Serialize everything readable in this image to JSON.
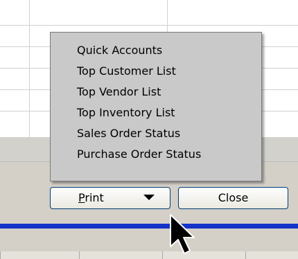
{
  "menu": {
    "items": [
      {
        "label": "Quick Accounts"
      },
      {
        "label": "Top Customer List"
      },
      {
        "label": "Top Vendor List"
      },
      {
        "label": "Top Inventory List"
      },
      {
        "label": "Sales Order Status"
      },
      {
        "label": "Purchase Order Status"
      }
    ]
  },
  "buttons": {
    "print_label": "Print",
    "print_accesskey": "P",
    "print_rest": "rint",
    "close_label": "Close"
  },
  "colors": {
    "accent_bar": "#1433c8",
    "button_border": "#003c74",
    "menu_background": "#c9c9c9"
  }
}
